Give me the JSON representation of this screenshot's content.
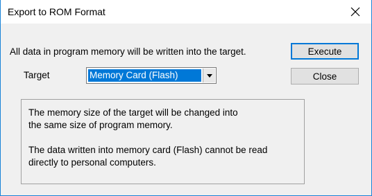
{
  "window": {
    "title": "Export to ROM Format",
    "close_icon": "close-x-icon"
  },
  "message": "All data in program memory will be written into the target.",
  "target": {
    "label": "Target",
    "selected": "Memory Card (Flash)",
    "dropdown_icon": "chevron-down-icon"
  },
  "buttons": {
    "execute": "Execute",
    "close": "Close"
  },
  "info": {
    "para1": "The memory size of the target will be changed into\nthe same size of program memory.",
    "para2": "The data written into memory card (Flash) cannot be read\ndirectly to personal computers."
  },
  "colors": {
    "accent": "#0078d7",
    "border": "#1883d7",
    "background": "#f0f0f0"
  }
}
